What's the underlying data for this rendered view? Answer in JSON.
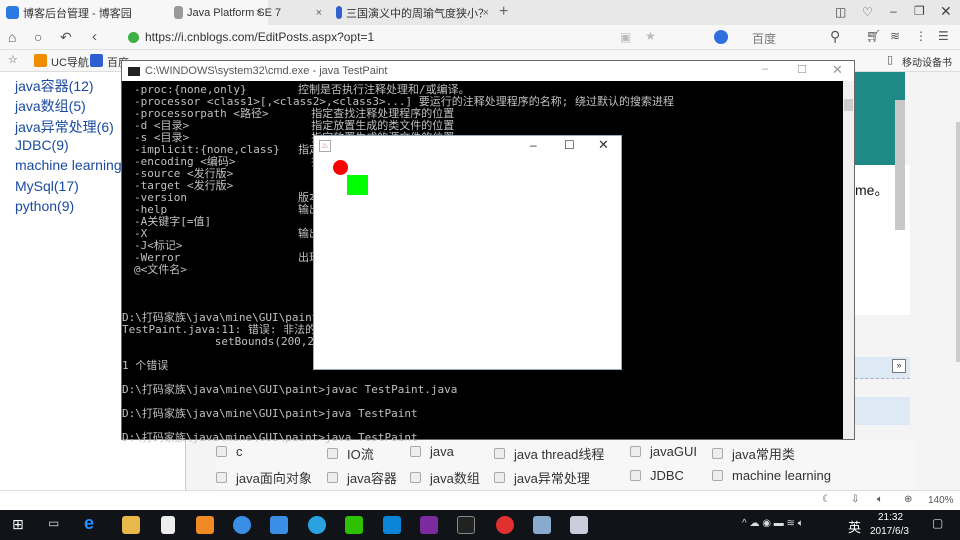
{
  "browser": {
    "tabs": [
      {
        "label": "博客后台管理 - 博客园",
        "active": true
      },
      {
        "label": "Java Platform SE 7",
        "active": false
      },
      {
        "label": "三国演义中的周瑜气度狭小？",
        "active": false
      }
    ],
    "url": "https://i.cnblogs.com/EditPosts.aspx?opt=1",
    "search_engine": "百度",
    "bookmarks": [
      "UC导航",
      "百度"
    ],
    "mobile_bookmarks": "移动设备书签",
    "zoom": "140%"
  },
  "sidebar": {
    "categories": [
      "java容器(12)",
      "java数组(5)",
      "java异常处理(6)",
      "JDBC(9)",
      "machine learning",
      "MySql(17)",
      "python(9)"
    ]
  },
  "page": {
    "fragment_text": "me。",
    "checkboxes": [
      "c",
      "IO流",
      "java",
      "java thread线程",
      "javaGUI",
      "java常用类",
      "java面向对象",
      "java容器",
      "java数组",
      "java异常处理",
      "JDBC",
      "machine learning"
    ]
  },
  "cmd": {
    "title": "C:\\WINDOWS\\system32\\cmd.exe - java  TestPaint",
    "lines": [
      [
        "-proc:{none,only}",
        "控制是否执行注释处理和/或编译。"
      ],
      [
        "-processor <class1>[,<class2>,<class3>...] 要运行的注释处理程序的名称; 绕过默认的搜索进程",
        ""
      ],
      [
        "-processorpath <路径>",
        "  指定查找注释处理程序的位置"
      ],
      [
        "-d <目录>",
        "  指定放置生成的类文件的位置"
      ],
      [
        "-s <目录>",
        "  指定放置生成的源文件的位置"
      ],
      [
        "-implicit:{none,class}",
        "指定"
      ],
      [
        "-encoding <编码>",
        "  指"
      ],
      [
        "-source <发行版>",
        ""
      ],
      [
        "-target <发行版>",
        ""
      ],
      [
        "-version",
        "版本"
      ],
      [
        "-help",
        "输出"
      ],
      [
        "-A关键字[=值]",
        ""
      ],
      [
        "-X",
        "输出"
      ],
      [
        "-J<标记>",
        ""
      ],
      [
        "-Werror",
        "出现"
      ],
      [
        "@<文件名>",
        ""
      ]
    ],
    "output": [
      "",
      "",
      "",
      "D:\\打码家族\\java\\mine\\GUI\\paint>",
      "TestPaint.java:11: 错误: 非法的",
      "              setBounds(200,20",
      "",
      "1 个错误",
      "",
      "D:\\打码家族\\java\\mine\\GUI\\paint>javac TestPaint.java",
      "",
      "D:\\打码家族\\java\\mine\\GUI\\paint>java TestPaint",
      "",
      "D:\\打码家族\\java\\mine\\GUI\\paint>java TestPaint"
    ]
  },
  "java_frame": {
    "shapes": [
      {
        "type": "circle",
        "color": "#ff0000"
      },
      {
        "type": "square",
        "color": "#00ff00"
      }
    ]
  },
  "taskbar": {
    "time": "21:32",
    "date": "2017/6/3",
    "ime": "英"
  }
}
